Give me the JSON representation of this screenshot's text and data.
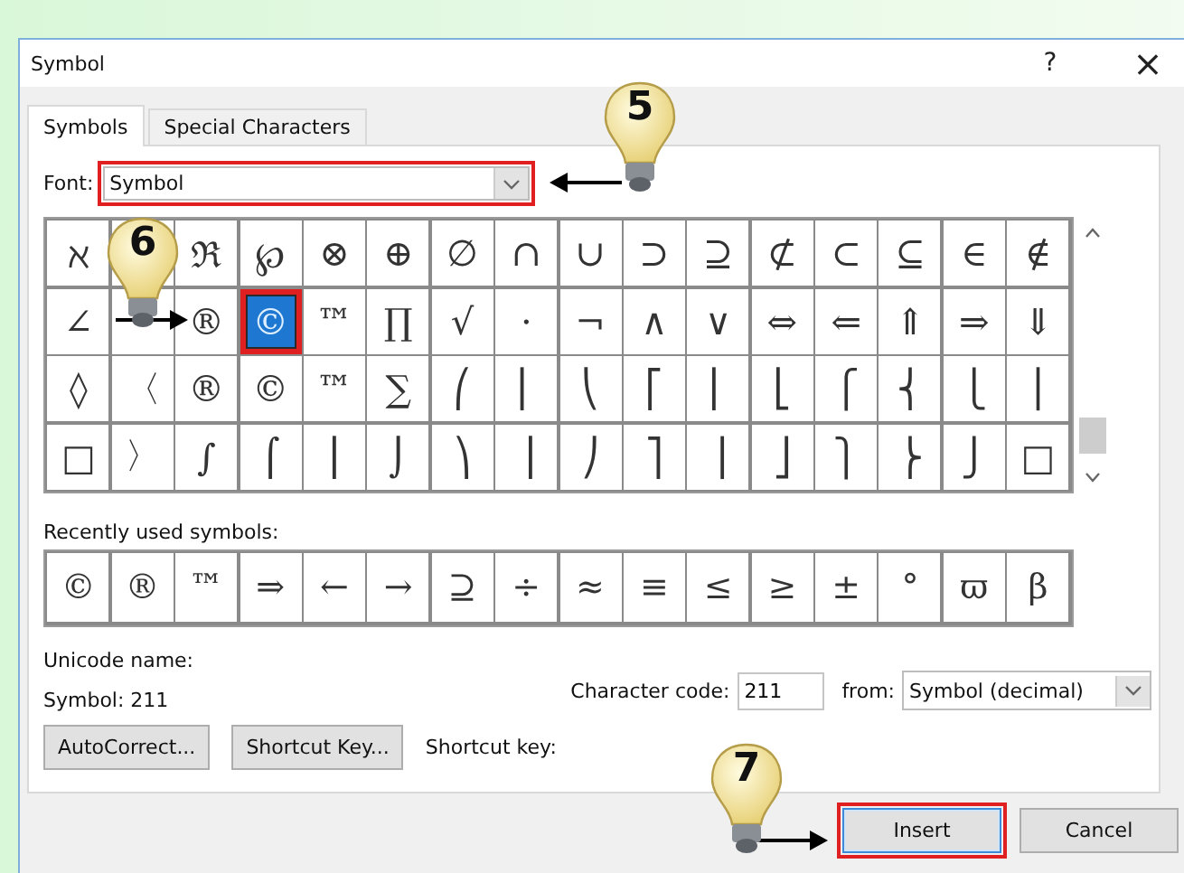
{
  "window": {
    "title": "Symbol",
    "help": "?",
    "close": "×"
  },
  "tabs": [
    {
      "label": "Symbols",
      "selected": true
    },
    {
      "label": "Special Characters",
      "selected": false
    }
  ],
  "font": {
    "label": "Font:",
    "value": "Symbol",
    "highlighted": true
  },
  "symbol_grid": [
    [
      {
        "symbol": "ℵ",
        "selected": false
      },
      {
        "selected": false
      },
      {
        "symbol": "ℜ",
        "selected": false
      },
      {
        "symbol": "℘",
        "selected": false
      },
      {
        "symbol": "⊗",
        "selected": false
      },
      {
        "symbol": "⊕",
        "selected": false
      },
      {
        "symbol": "∅",
        "selected": false
      },
      {
        "symbol": "∩",
        "selected": false
      },
      {
        "symbol": "∪",
        "selected": false
      },
      {
        "symbol": "⊃",
        "selected": false
      },
      {
        "symbol": "⊇",
        "selected": false
      },
      {
        "symbol": "⊄",
        "selected": false
      },
      {
        "symbol": "⊂",
        "selected": false
      },
      {
        "symbol": "⊆",
        "selected": false
      },
      {
        "symbol": "∈",
        "selected": false
      },
      {
        "symbol": "∉",
        "selected": false
      }
    ],
    [
      {
        "symbol": "∠",
        "selected": false
      },
      {
        "selected": false
      },
      {
        "symbol": "®",
        "selected": false
      },
      {
        "symbol": "©",
        "selected": true,
        "highlighted": true
      },
      {
        "symbol": "™",
        "selected": false
      },
      {
        "symbol": "∏",
        "selected": false
      },
      {
        "symbol": "√",
        "selected": false
      },
      {
        "symbol": "⋅",
        "selected": false
      },
      {
        "symbol": "¬",
        "selected": false
      },
      {
        "symbol": "∧",
        "selected": false
      },
      {
        "symbol": "∨",
        "selected": false
      },
      {
        "symbol": "⇔",
        "selected": false
      },
      {
        "symbol": "⇐",
        "selected": false
      },
      {
        "symbol": "⇑",
        "selected": false
      },
      {
        "symbol": "⇒",
        "selected": false
      },
      {
        "symbol": "⇓",
        "selected": false
      }
    ],
    [
      {
        "symbol": "◊",
        "selected": false
      },
      {
        "symbol": "〈",
        "selected": false
      },
      {
        "symbol": "®",
        "selected": false
      },
      {
        "symbol": "©",
        "selected": false
      },
      {
        "symbol": "™",
        "selected": false
      },
      {
        "symbol": "∑",
        "selected": false
      },
      {
        "symbol": "⎛",
        "selected": false
      },
      {
        "symbol": "⎜",
        "selected": false
      },
      {
        "symbol": "⎝",
        "selected": false
      },
      {
        "symbol": "⎡",
        "selected": false
      },
      {
        "symbol": "⎢",
        "selected": false
      },
      {
        "symbol": "⎣",
        "selected": false
      },
      {
        "symbol": "⎧",
        "selected": false
      },
      {
        "symbol": "⎨",
        "selected": false
      },
      {
        "symbol": "⎩",
        "selected": false
      },
      {
        "symbol": "⎪",
        "selected": false
      }
    ],
    [
      {
        "symbol": "□",
        "selected": false
      },
      {
        "symbol": "〉",
        "selected": false
      },
      {
        "symbol": "∫",
        "selected": false
      },
      {
        "symbol": "⌠",
        "selected": false
      },
      {
        "symbol": "⎮",
        "selected": false
      },
      {
        "symbol": "⌡",
        "selected": false
      },
      {
        "symbol": "⎞",
        "selected": false
      },
      {
        "symbol": "⎟",
        "selected": false
      },
      {
        "symbol": "⎠",
        "selected": false
      },
      {
        "symbol": "⎤",
        "selected": false
      },
      {
        "symbol": "⎥",
        "selected": false
      },
      {
        "symbol": "⎦",
        "selected": false
      },
      {
        "symbol": "⎫",
        "selected": false
      },
      {
        "symbol": "⎬",
        "selected": false
      },
      {
        "symbol": "⎭",
        "selected": false
      },
      {
        "symbol": "□",
        "selected": false
      }
    ]
  ],
  "recent": {
    "label": "Recently used symbols:",
    "symbols": [
      "©",
      "®",
      "™",
      "⇒",
      "←",
      "→",
      "⊇",
      "÷",
      "≈",
      "≡",
      "≤",
      "≥",
      "±",
      "°",
      "ϖ",
      "β"
    ]
  },
  "unicode_name": {
    "label": "Unicode name:",
    "value": "Symbol: 211"
  },
  "character_code": {
    "label": "Character code:",
    "value": "211",
    "from_label": "from:",
    "from_value": "Symbol (decimal)"
  },
  "buttons": [
    {
      "label": "AutoCorrect..."
    },
    {
      "label": "Shortcut Key..."
    }
  ],
  "shortcut_key": {
    "label": "Shortcut key:"
  },
  "footer_buttons": [
    {
      "label": "Insert",
      "highlighted": true
    },
    {
      "label": "Cancel",
      "highlighted": false
    }
  ],
  "callouts": [
    {
      "number": "5",
      "kind": "left"
    },
    {
      "number": "6",
      "kind": "right"
    },
    {
      "number": "7",
      "kind": "right"
    }
  ]
}
